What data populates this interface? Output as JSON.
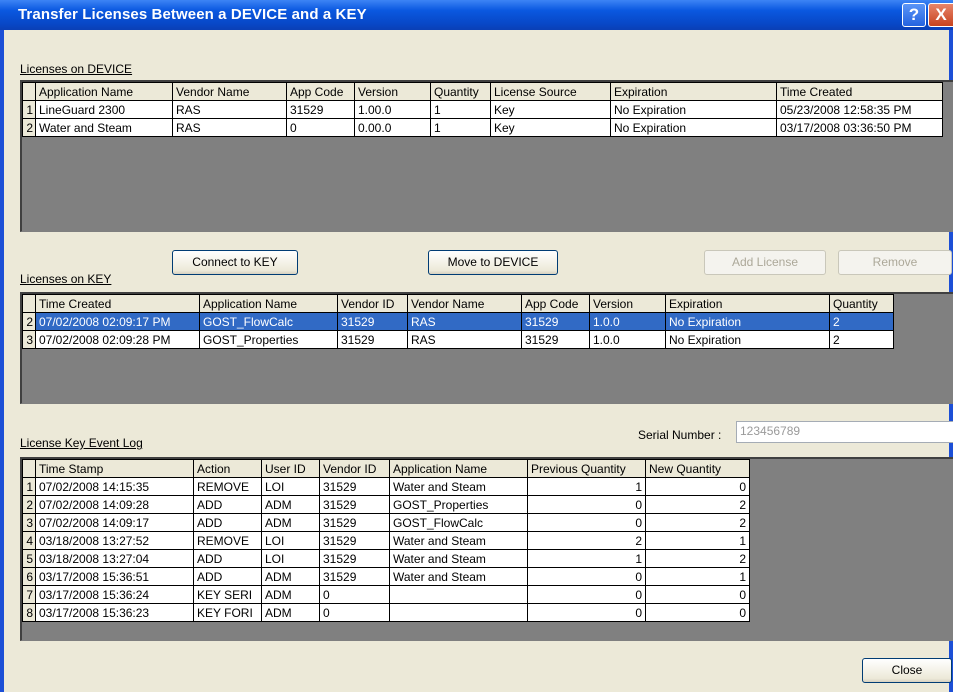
{
  "window": {
    "title": "Transfer Licenses Between a DEVICE and a KEY",
    "help_label": "?",
    "close_label": "X"
  },
  "device": {
    "label": "Licenses on DEVICE",
    "columns": [
      "",
      "Application Name",
      "Vendor Name",
      "App Code",
      "Version",
      "Quantity",
      "License Source",
      "Expiration",
      "Time Created"
    ],
    "rows": [
      [
        "1",
        "LineGuard 2300",
        "RAS",
        "31529",
        "1.00.0",
        "1",
        "Key",
        "No Expiration",
        "05/23/2008 12:58:35 PM"
      ],
      [
        "2",
        "Water and Steam",
        "RAS",
        "0",
        "0.00.0",
        "1",
        "Key",
        "No Expiration",
        "03/17/2008 03:36:50 PM"
      ]
    ]
  },
  "buttons": {
    "connect": "Connect to KEY",
    "move": "Move to DEVICE",
    "add_license": "Add License",
    "remove": "Remove",
    "close": "Close"
  },
  "key": {
    "label": "Licenses on KEY",
    "columns": [
      "",
      "Time Created",
      "Application Name",
      "Vendor ID",
      "Vendor Name",
      "App Code",
      "Version",
      "Expiration",
      "Quantity"
    ],
    "rows": [
      [
        "2",
        "07/02/2008 02:09:17 PM",
        "GOST_FlowCalc",
        "31529",
        "RAS",
        "31529",
        "1.0.0",
        "No Expiration",
        "2"
      ],
      [
        "3",
        "07/02/2008 02:09:28 PM",
        "GOST_Properties",
        "31529",
        "RAS",
        "31529",
        "1.0.0",
        "No Expiration",
        "2"
      ]
    ],
    "selected_row": 0
  },
  "serial": {
    "label": "Serial Number :",
    "value": "123456789"
  },
  "log": {
    "label": "License Key Event Log",
    "columns": [
      "",
      "Time Stamp",
      "Action",
      "User ID",
      "Vendor ID",
      "Application Name",
      "Previous Quantity",
      "New Quantity"
    ],
    "rows": [
      [
        "1",
        "07/02/2008 14:15:35",
        "REMOVE",
        "LOI",
        "31529",
        "Water and Steam",
        "1",
        "0"
      ],
      [
        "2",
        "07/02/2008 14:09:28",
        "ADD",
        "ADM",
        "31529",
        "GOST_Properties",
        "0",
        "2"
      ],
      [
        "3",
        "07/02/2008 14:09:17",
        "ADD",
        "ADM",
        "31529",
        "GOST_FlowCalc",
        "0",
        "2"
      ],
      [
        "4",
        "03/18/2008 13:27:52",
        "REMOVE",
        "LOI",
        "31529",
        "Water and Steam",
        "2",
        "1"
      ],
      [
        "5",
        "03/18/2008 13:27:04",
        "ADD",
        "LOI",
        "31529",
        "Water and Steam",
        "1",
        "2"
      ],
      [
        "6",
        "03/17/2008 15:36:51",
        "ADD",
        "ADM",
        "31529",
        "Water and Steam",
        "0",
        "1"
      ],
      [
        "7",
        "03/17/2008 15:36:24",
        "KEY SERI",
        "ADM",
        "0",
        "",
        "0",
        "0"
      ],
      [
        "8",
        "03/17/2008 15:36:23",
        "KEY FORI",
        "ADM",
        "0",
        "",
        "0",
        "0"
      ]
    ]
  }
}
